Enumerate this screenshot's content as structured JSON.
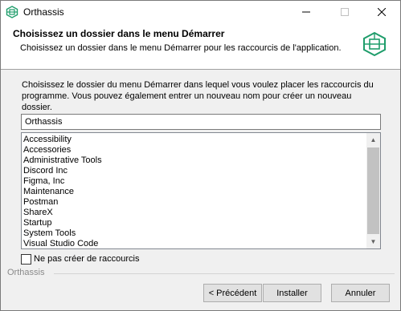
{
  "window": {
    "title": "Orthassis",
    "icon": "orthassis-logo-icon",
    "controls": [
      "minimize-icon",
      "maximize-icon",
      "close-icon"
    ]
  },
  "header": {
    "title": "Choisissez un dossier dans le menu Démarrer",
    "subtitle": "Choisissez un dossier dans le menu Démarrer pour les raccourcis de l'application.",
    "logo_icon": "orthassis-logo-icon",
    "accent_color": "#1f9d6b"
  },
  "main": {
    "description": "Choisissez le dossier du menu Démarrer dans lequel vous voulez placer les raccourcis du programme. Vous pouvez également entrer un nouveau nom pour créer un nouveau dossier.",
    "folder_name": "Orthassis",
    "folders": [
      "Accessibility",
      "Accessories",
      "Administrative Tools",
      "Discord Inc",
      "Figma, Inc",
      "Maintenance",
      "Postman",
      "ShareX",
      "Startup",
      "System Tools",
      "Visual Studio Code"
    ],
    "no_shortcuts_label": "Ne pas créer de raccourcis",
    "no_shortcuts_checked": false
  },
  "footer": {
    "brand": "Orthassis",
    "back_label": "< Précédent",
    "install_label": "Installer",
    "cancel_label": "Annuler"
  }
}
